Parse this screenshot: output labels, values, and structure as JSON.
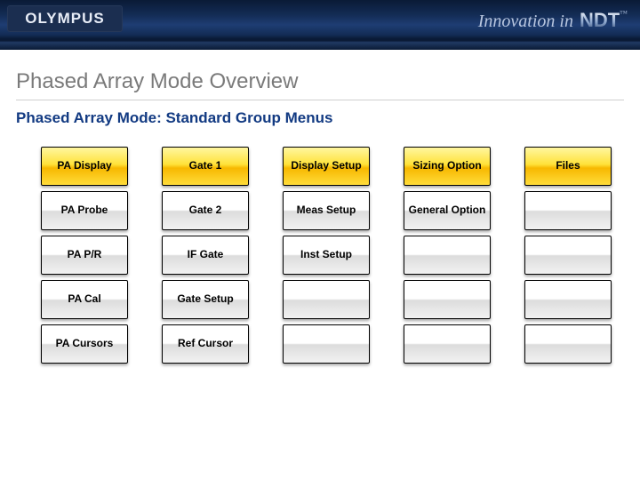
{
  "header": {
    "logo_text": "OLYMPUS",
    "tagline_prefix": "Innovation in ",
    "tagline_ndt": "NDT",
    "tagline_tm": "™"
  },
  "title": "Phased Array Mode Overview",
  "subtitle": "Phased Array Mode: Standard Group Menus",
  "columns": [
    {
      "active_index": 0,
      "items": [
        "PA Display",
        "PA Probe",
        "PA P/R",
        "PA Cal",
        "PA Cursors"
      ]
    },
    {
      "active_index": 0,
      "items": [
        "Gate 1",
        "Gate 2",
        "IF Gate",
        "Gate Setup",
        "Ref Cursor"
      ]
    },
    {
      "active_index": 0,
      "items": [
        "Display Setup",
        "Meas Setup",
        "Inst Setup",
        "",
        ""
      ]
    },
    {
      "active_index": 0,
      "items": [
        "Sizing Option",
        "General Option",
        "",
        "",
        ""
      ]
    },
    {
      "active_index": 0,
      "items": [
        "Files",
        "",
        "",
        "",
        ""
      ]
    }
  ]
}
